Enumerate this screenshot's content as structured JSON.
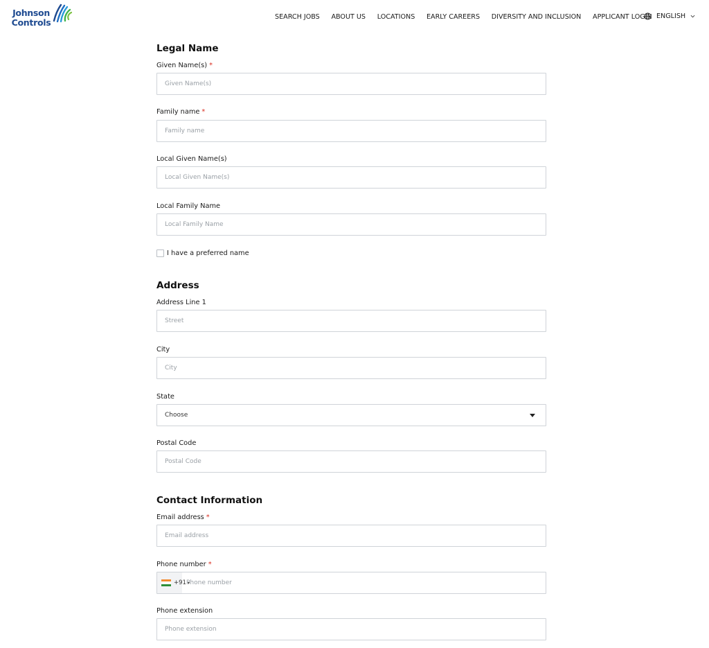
{
  "header": {
    "logo_line1": "Johnson",
    "logo_line2": "Controls",
    "nav": [
      {
        "label": "SEARCH JOBS"
      },
      {
        "label": "ABOUT US"
      },
      {
        "label": "LOCATIONS"
      },
      {
        "label": "EARLY CAREERS"
      },
      {
        "label": "DIVERSITY AND INCLUSION"
      },
      {
        "label": "APPLICANT LOGIN"
      }
    ],
    "language": "ENGLISH"
  },
  "legal_name": {
    "title": "Legal Name",
    "given_label": "Given Name(s)",
    "given_placeholder": "Given Name(s)",
    "family_label": "Family name",
    "family_placeholder": "Family name",
    "local_given_label": "Local Given Name(s)",
    "local_given_placeholder": "Local Given Name(s)",
    "local_family_label": "Local Family Name",
    "local_family_placeholder": "Local Family Name",
    "preferred_checkbox": "I have a preferred name"
  },
  "address": {
    "title": "Address",
    "line1_label": "Address Line 1",
    "line1_placeholder": "Street",
    "city_label": "City",
    "city_placeholder": "City",
    "state_label": "State",
    "state_value": "Choose",
    "postal_label": "Postal Code",
    "postal_placeholder": "Postal Code"
  },
  "contact": {
    "title": "Contact Information",
    "email_label": "Email address",
    "email_placeholder": "Email address",
    "phone_label": "Phone number",
    "phone_code": "+91",
    "phone_placeholder": "Phone number",
    "ext_label": "Phone extension",
    "ext_placeholder": "Phone extension"
  },
  "required_marker": "*",
  "colors": {
    "brand": "#1f4b91",
    "required": "#d92d20"
  }
}
